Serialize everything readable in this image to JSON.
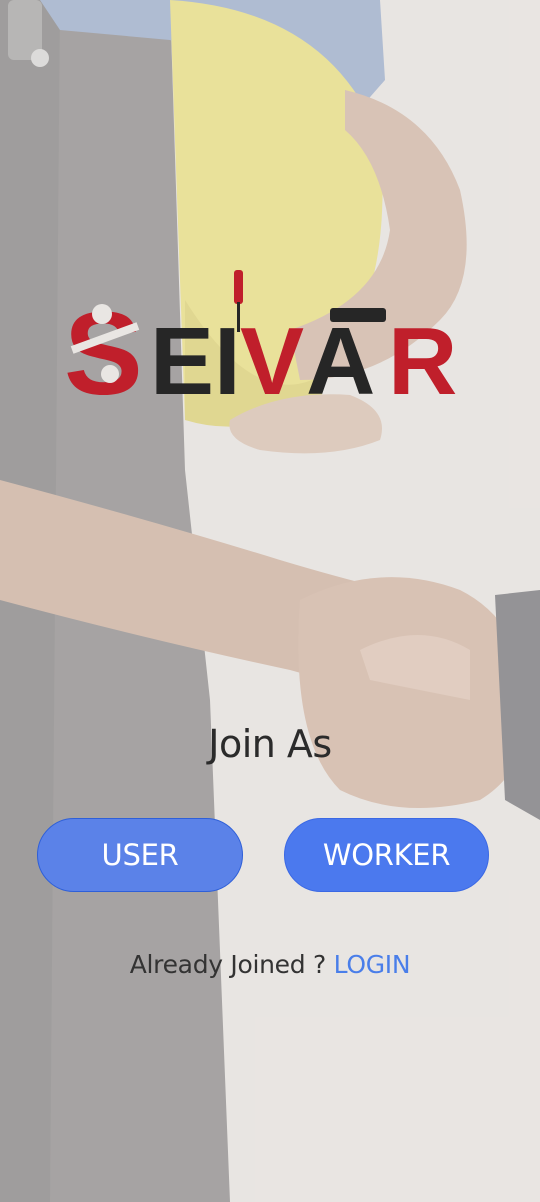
{
  "logo": {
    "text": "SEIVAR",
    "letters": [
      "S",
      "E",
      "I",
      "V",
      "A",
      "R"
    ]
  },
  "join": {
    "title": "Join As"
  },
  "buttons": {
    "user": "USER",
    "worker": "WORKER"
  },
  "login_prompt": {
    "text": "Already Joined ? ",
    "link": "LOGIN"
  },
  "colors": {
    "brand_red": "#c01f2b",
    "brand_dark": "#262626",
    "button_blue": "#4b79ee",
    "link_blue": "#4a7ee9"
  }
}
